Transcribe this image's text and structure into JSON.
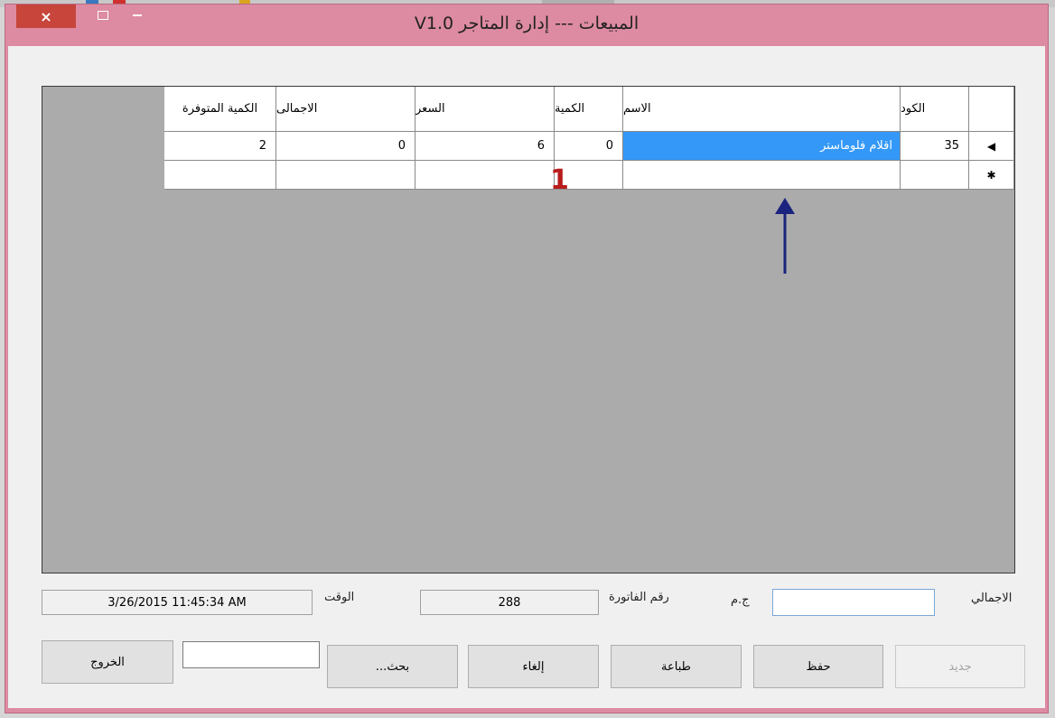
{
  "window": {
    "title": "المبيعات --- إدارة المتاجر V1.0",
    "close_glyph": "×"
  },
  "grid": {
    "headers": {
      "code": "الكود",
      "name": "الاسم",
      "quantity": "الكمية",
      "price": "السعر",
      "total": "الاجمالى",
      "available": "الكمية المتوفرة"
    },
    "rows": [
      {
        "indicator": "◀",
        "code": "35",
        "name": "اقلام فلوماستر",
        "quantity": "0",
        "price": "6",
        "total": "0",
        "available": "2"
      }
    ],
    "new_row_indicator": "✱"
  },
  "annotation": {
    "number": "1",
    "arrow_color": "#1a237e"
  },
  "summary": {
    "total_label": "الاجمالي",
    "total_value": "",
    "currency": "ج.م",
    "invoice_label": "رقم الفاتورة",
    "invoice_value": "288",
    "time_label": "الوقت",
    "time_value": "3/26/2015 11:45:34 AM"
  },
  "buttons": {
    "new": "جديد",
    "save": "حفظ",
    "print": "طباعة",
    "cancel": "إلغاء",
    "search": "بحث...",
    "search_value": "",
    "exit": "الخروج"
  },
  "colors": {
    "titlebar": "#dd8ba2",
    "close_button": "#c7453a",
    "selection": "#3398f7",
    "grid_background": "#ababab"
  }
}
